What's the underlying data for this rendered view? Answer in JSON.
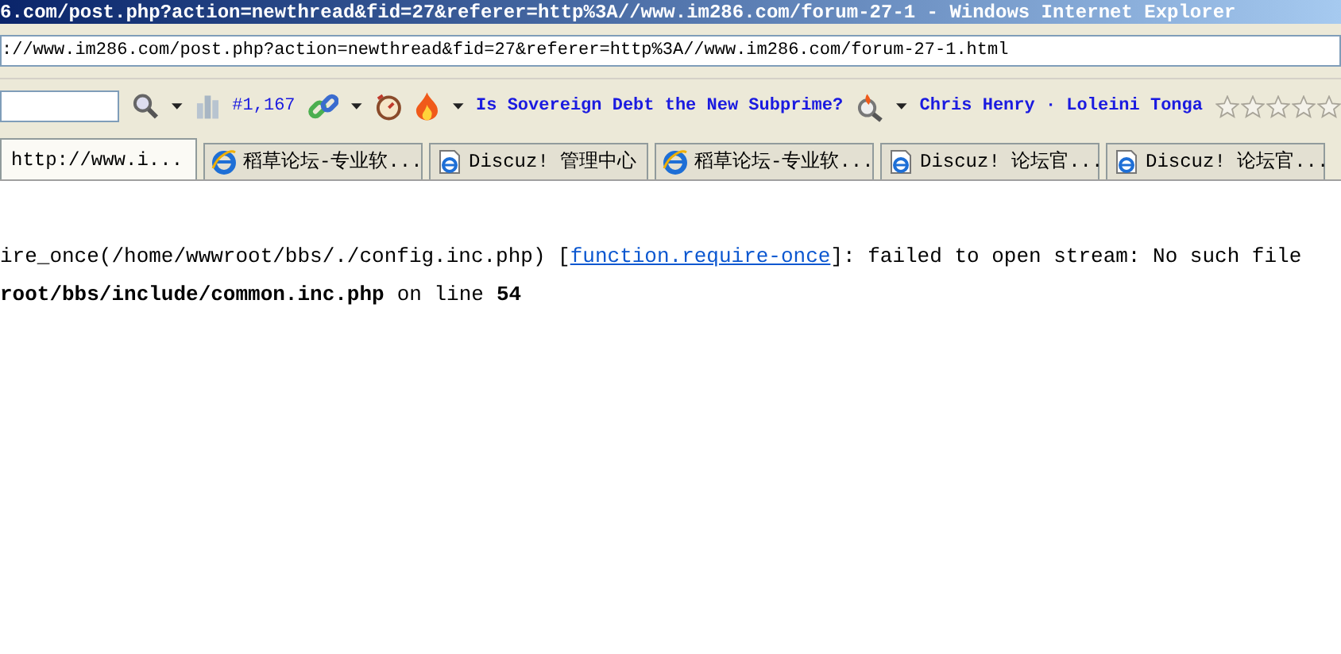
{
  "window": {
    "title": "6.com/post.php?action=newthread&fid=27&referer=http%3A//www.im286.com/forum-27-1 - Windows Internet Explorer"
  },
  "address_bar": {
    "value": "://www.im286.com/post.php?action=newthread&fid=27&referer=http%3A//www.im286.com/forum-27-1.html"
  },
  "toolbar": {
    "rank": "#1,167",
    "headline": "Is Sovereign Debt the New Subprime?",
    "names": "Chris Henry · Loleini Tonga",
    "stars": 0
  },
  "tabs": [
    {
      "label": "http://www.i...",
      "selected": true,
      "kind": "blank"
    },
    {
      "label": "稻草论坛-专业软...",
      "selected": false,
      "kind": "browser"
    },
    {
      "label": "Discuz! 管理中心",
      "selected": false,
      "kind": "document"
    },
    {
      "label": "稻草论坛-专业软...",
      "selected": false,
      "kind": "browser"
    },
    {
      "label": "Discuz! 论坛官...",
      "selected": false,
      "kind": "document"
    },
    {
      "label": "Discuz! 论坛官...",
      "selected": false,
      "kind": "document"
    }
  ],
  "error": {
    "line1_before": "ire_once(/home/wwwroot/bbs/./config.inc.php) [",
    "link": "function.require-once",
    "line1_after": "]: failed to open stream: No such file",
    "file": "root/bbs/include/common.inc.php",
    "on_line": "on line",
    "line_number": "54"
  }
}
